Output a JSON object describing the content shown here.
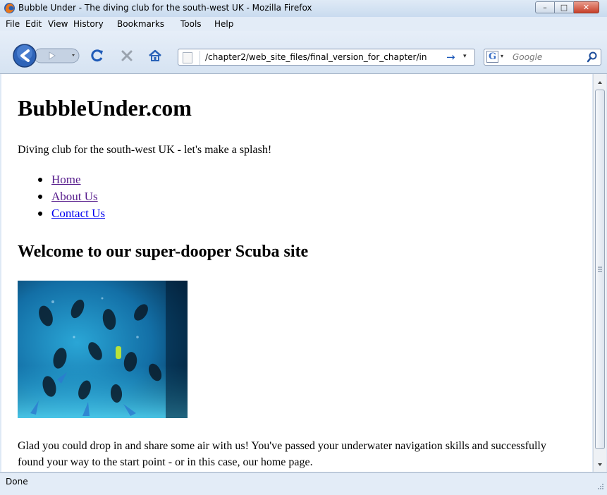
{
  "window": {
    "title": "Bubble Under - The diving club for the south-west UK - Mozilla Firefox",
    "controls": {
      "minimize": "–",
      "maximize": "□",
      "close": "✕"
    }
  },
  "menubar": {
    "items": [
      "File",
      "Edit",
      "View",
      "History",
      "Bookmarks",
      "Tools",
      "Help"
    ]
  },
  "toolbar": {
    "icons": [
      "back-icon",
      "forward-icon",
      "reload-icon",
      "stop-icon",
      "home-icon"
    ],
    "address": "/chapter2/web_site_files/final_version_for_chapter/in",
    "go_arrow": "→",
    "dropdown": "▾",
    "search_engine": "G",
    "search_placeholder": "Google"
  },
  "page": {
    "site_title": "BubbleUnder.com",
    "tagline": "Diving club for the south-west UK - let's make a splash!",
    "nav": [
      {
        "label": "Home",
        "visited": true
      },
      {
        "label": "About Us",
        "visited": true
      },
      {
        "label": "Contact Us",
        "visited": false
      }
    ],
    "welcome_heading": "Welcome to our super-dooper Scuba site",
    "photo_icon": "divers-photo",
    "body_text": "Glad you could drop in and share some air with us! You've passed your underwater navigation skills and successfully found your way to the start point - or in this case, our home page."
  },
  "statusbar": {
    "text": "Done"
  },
  "colors": {
    "link": "#0000ee",
    "visited_link": "#551a8b",
    "chrome": "#dfe9f5",
    "close_button": "#c7402a"
  }
}
